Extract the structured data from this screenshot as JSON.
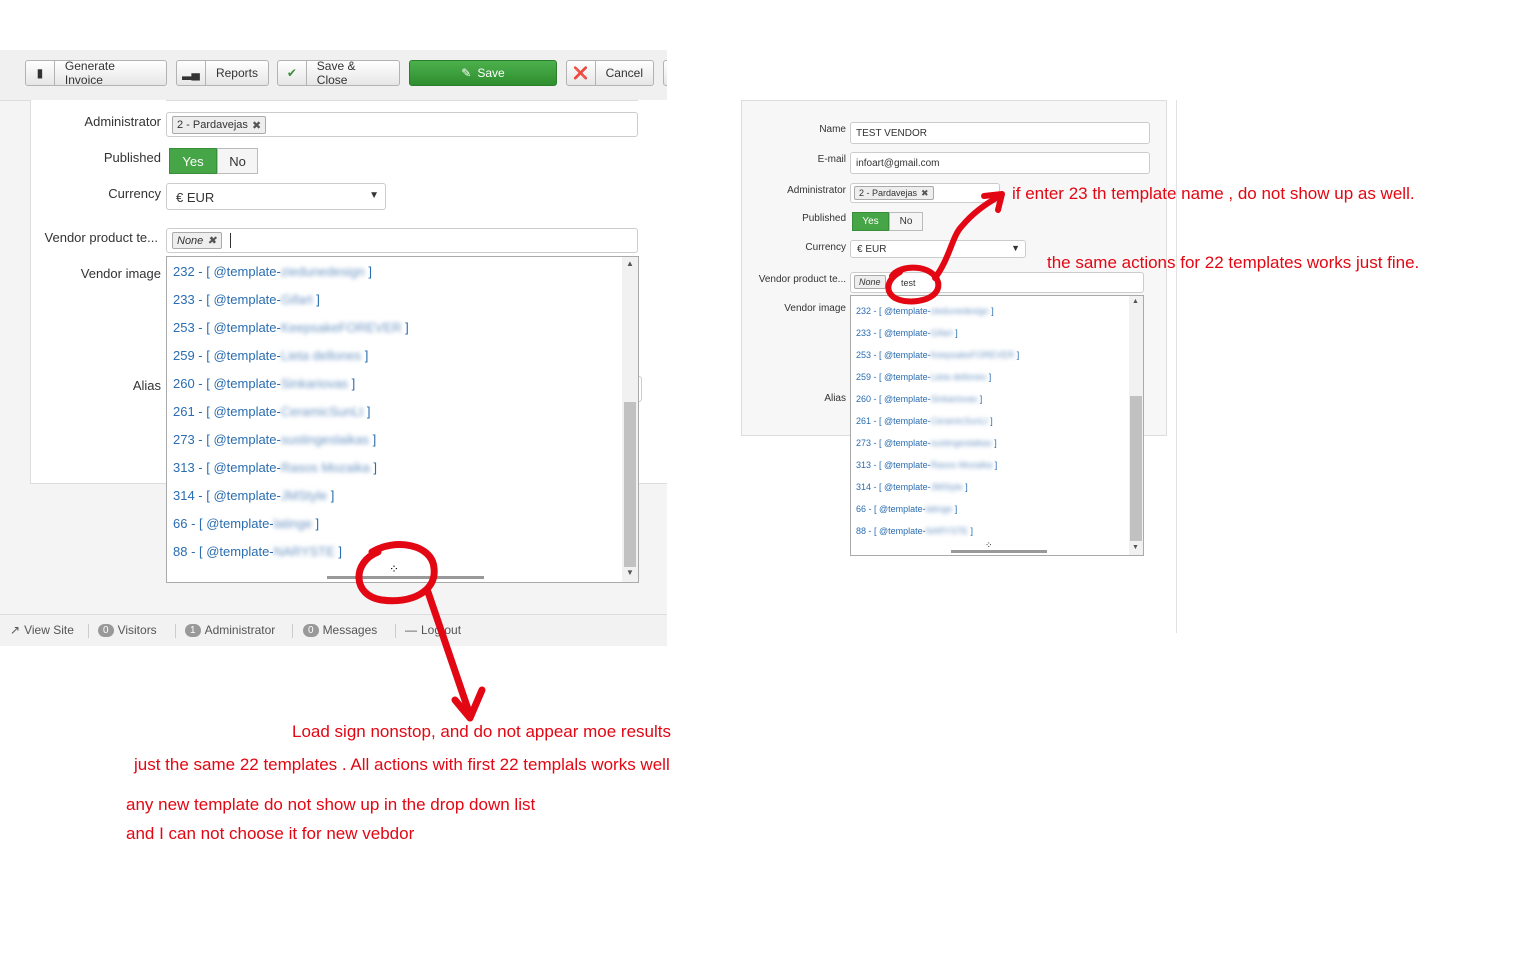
{
  "left": {
    "toolbar": {
      "generate_invoice": "Generate Invoice",
      "reports": "Reports",
      "save_close": "Save & Close",
      "save": "Save",
      "cancel": "Cancel"
    },
    "form": {
      "administrator_label": "Administrator",
      "administrator_chip": "2 - Pardavejas",
      "published_label": "Published",
      "yes": "Yes",
      "no": "No",
      "currency_label": "Currency",
      "currency_value": "€ EUR",
      "vendor_template_label": "Vendor product te...",
      "template_chip": "None",
      "vendor_image_label": "Vendor image",
      "alias_label": "Alias"
    },
    "options": [
      {
        "prefix": "232 - [ @template-",
        "hidden": "ziedunedesign",
        "suffix": " ]"
      },
      {
        "prefix": "233 - [ @template-",
        "hidden": "Gifart",
        "suffix": " ]"
      },
      {
        "prefix": "253 - [ @template-",
        "hidden": "KeepsakeFOREVER",
        "suffix": " ]"
      },
      {
        "prefix": "259 - [ @template-",
        "hidden": "Lieta dellones",
        "suffix": " ]"
      },
      {
        "prefix": "260 - [ @template-",
        "hidden": "Sinkariovas",
        "suffix": " ]"
      },
      {
        "prefix": "261 - [ @template-",
        "hidden": "CeramicSunLt",
        "suffix": " ]"
      },
      {
        "prefix": "273 - [ @template-",
        "hidden": "sustingeslaikas",
        "suffix": " ]"
      },
      {
        "prefix": "313 - [ @template-",
        "hidden": "Rasos Mozaika",
        "suffix": " ]"
      },
      {
        "prefix": "314 - [ @template-",
        "hidden": "JMStyle",
        "suffix": " ]"
      },
      {
        "prefix": "66 - [ @template-",
        "hidden": "latinge",
        "suffix": " ]"
      },
      {
        "prefix": "88 - [ @template-",
        "hidden": "NARYSTE",
        "suffix": " ]"
      }
    ],
    "loader_glyph": "⁘",
    "status": {
      "view_site": "View Site",
      "visitors_count": "0",
      "visitors": "Visitors",
      "admin_count": "1",
      "administrator": "Administrator",
      "messages_count": "0",
      "messages": "Messages",
      "logout": "Log out"
    }
  },
  "right": {
    "name_label": "Name",
    "name_value": "TEST VENDOR",
    "email_label": "E-mail",
    "email_value": "infoart@gmail.com",
    "administrator_label": "Administrator",
    "administrator_chip": "2 - Pardavejas",
    "published_label": "Published",
    "yes": "Yes",
    "no": "No",
    "currency_label": "Currency",
    "currency_value": "€ EUR",
    "vendor_template_label": "Vendor product te...",
    "template_chip": "None",
    "search_text": "test",
    "vendor_image_label": "Vendor image",
    "alias_label": "Alias"
  },
  "annotations": {
    "right_1": "if enter 23 th  template name , do not show up as well.",
    "right_2": "the same actions for 22 templates works just fine.",
    "bottom_1": "Load sign nonstop, and do not appear moe results",
    "bottom_2": "just the same 22 templates . All actions with first 22 templals works well",
    "bottom_3": "any new template do not show up in the drop down list",
    "bottom_4": "and I can not  choose it for new vebdor",
    "ink_color": "#e30613"
  }
}
